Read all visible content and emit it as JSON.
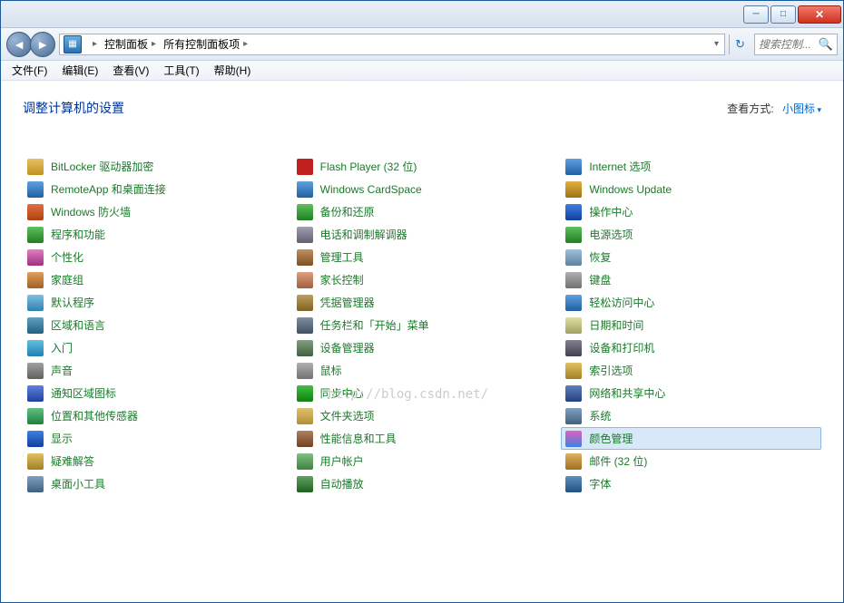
{
  "breadcrumb": [
    "控制面板",
    "所有控制面板项"
  ],
  "search": {
    "placeholder": "搜索控制..."
  },
  "menu": [
    "文件(F)",
    "编辑(E)",
    "查看(V)",
    "工具(T)",
    "帮助(H)"
  ],
  "heading": "调整计算机的设置",
  "viewby": {
    "label": "查看方式:",
    "value": "小图标"
  },
  "watermark": "http://blog.csdn.net/",
  "selected": "颜色管理",
  "columns": [
    [
      {
        "label": "BitLocker 驱动器加密",
        "icon": "ic-lock",
        "name": "item-bitlocker"
      },
      {
        "label": "RemoteApp 和桌面连接",
        "icon": "ic-remote",
        "name": "item-remoteapp"
      },
      {
        "label": "Windows 防火墙",
        "icon": "ic-fire",
        "name": "item-firewall"
      },
      {
        "label": "程序和功能",
        "icon": "ic-prog",
        "name": "item-programs"
      },
      {
        "label": "个性化",
        "icon": "ic-pers",
        "name": "item-personalization"
      },
      {
        "label": "家庭组",
        "icon": "ic-home",
        "name": "item-homegroup"
      },
      {
        "label": "默认程序",
        "icon": "ic-def",
        "name": "item-default-programs"
      },
      {
        "label": "区域和语言",
        "icon": "ic-region",
        "name": "item-region"
      },
      {
        "label": "入门",
        "icon": "ic-start",
        "name": "item-getting-started"
      },
      {
        "label": "声音",
        "icon": "ic-sound",
        "name": "item-sound"
      },
      {
        "label": "通知区域图标",
        "icon": "ic-notif",
        "name": "item-notification-icons"
      },
      {
        "label": "位置和其他传感器",
        "icon": "ic-loc",
        "name": "item-location-sensors"
      },
      {
        "label": "显示",
        "icon": "ic-disp",
        "name": "item-display"
      },
      {
        "label": "疑难解答",
        "icon": "ic-trouble",
        "name": "item-troubleshooting"
      },
      {
        "label": "桌面小工具",
        "icon": "ic-gadget",
        "name": "item-gadgets"
      }
    ],
    [
      {
        "label": "Flash Player (32 位)",
        "icon": "ic-flash",
        "name": "item-flash"
      },
      {
        "label": "Windows CardSpace",
        "icon": "ic-card",
        "name": "item-cardspace"
      },
      {
        "label": "备份和还原",
        "icon": "ic-backup",
        "name": "item-backup"
      },
      {
        "label": "电话和调制解调器",
        "icon": "ic-phone",
        "name": "item-phone-modem"
      },
      {
        "label": "管理工具",
        "icon": "ic-admin",
        "name": "item-admin-tools"
      },
      {
        "label": "家长控制",
        "icon": "ic-parent",
        "name": "item-parental"
      },
      {
        "label": "凭据管理器",
        "icon": "ic-cred",
        "name": "item-credentials"
      },
      {
        "label": "任务栏和「开始」菜单",
        "icon": "ic-task",
        "name": "item-taskbar"
      },
      {
        "label": "设备管理器",
        "icon": "ic-devmgr",
        "name": "item-device-manager"
      },
      {
        "label": "鼠标",
        "icon": "ic-mouse",
        "name": "item-mouse"
      },
      {
        "label": "同步中心",
        "icon": "ic-sync",
        "name": "item-sync-center"
      },
      {
        "label": "文件夹选项",
        "icon": "ic-folder",
        "name": "item-folder-options"
      },
      {
        "label": "性能信息和工具",
        "icon": "ic-perf",
        "name": "item-performance"
      },
      {
        "label": "用户帐户",
        "icon": "ic-user",
        "name": "item-user-accounts"
      },
      {
        "label": "自动播放",
        "icon": "ic-auto",
        "name": "item-autoplay"
      }
    ],
    [
      {
        "label": "Internet 选项",
        "icon": "ic-inet",
        "name": "item-internet-options"
      },
      {
        "label": "Windows Update",
        "icon": "ic-wup",
        "name": "item-windows-update"
      },
      {
        "label": "操作中心",
        "icon": "ic-action",
        "name": "item-action-center"
      },
      {
        "label": "电源选项",
        "icon": "ic-power",
        "name": "item-power"
      },
      {
        "label": "恢复",
        "icon": "ic-recov",
        "name": "item-recovery"
      },
      {
        "label": "键盘",
        "icon": "ic-kbd",
        "name": "item-keyboard"
      },
      {
        "label": "轻松访问中心",
        "icon": "ic-ease",
        "name": "item-ease-of-access"
      },
      {
        "label": "日期和时间",
        "icon": "ic-date",
        "name": "item-date-time"
      },
      {
        "label": "设备和打印机",
        "icon": "ic-print",
        "name": "item-devices-printers"
      },
      {
        "label": "索引选项",
        "icon": "ic-index",
        "name": "item-indexing"
      },
      {
        "label": "网络和共享中心",
        "icon": "ic-net",
        "name": "item-network-sharing"
      },
      {
        "label": "系统",
        "icon": "ic-sys",
        "name": "item-system"
      },
      {
        "label": "颜色管理",
        "icon": "ic-color",
        "name": "item-color-management"
      },
      {
        "label": "邮件 (32 位)",
        "icon": "ic-mail",
        "name": "item-mail"
      },
      {
        "label": "字体",
        "icon": "ic-font",
        "name": "item-fonts"
      }
    ]
  ]
}
